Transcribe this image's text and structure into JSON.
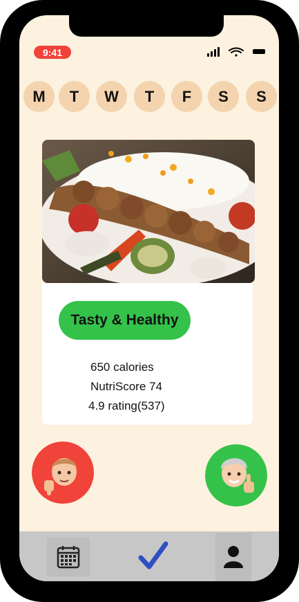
{
  "status_bar": {
    "time": "9:41"
  },
  "week_days": [
    "M",
    "T",
    "W",
    "T",
    "F",
    "S",
    "S"
  ],
  "meal": {
    "image": "kebab-rice-plate",
    "badge": "Tasty & Healthy",
    "calories": "650 calories",
    "nutriscore": "NutriScore 74",
    "rating": "4.9 rating(537)"
  },
  "actions": {
    "dislike": "thumbs-down-avatar",
    "like": "thumbs-up-avatar"
  },
  "tab_bar": {
    "items": [
      "calendar-icon",
      "checkmark-icon",
      "person-icon"
    ]
  },
  "colors": {
    "background": "#fdf1df",
    "day_circle": "#f3d4ae",
    "badge": "#35c24a",
    "dislike": "#f0433a",
    "like": "#35c24a",
    "check": "#2f4fc2",
    "tab_bar": "#c7c7c7"
  }
}
